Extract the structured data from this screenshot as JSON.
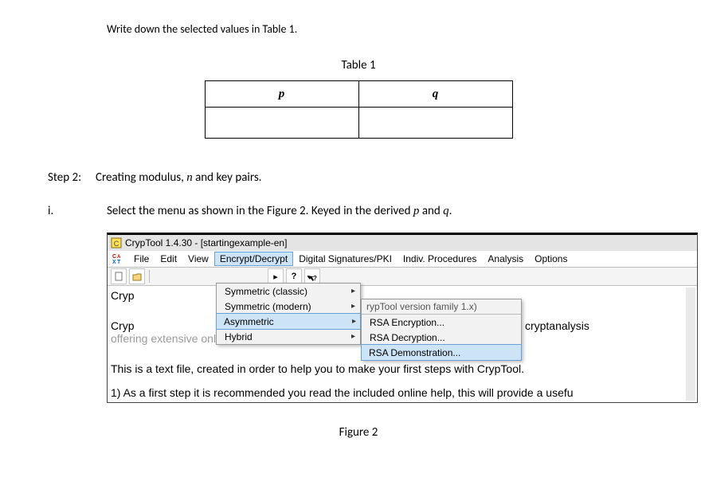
{
  "instruction": "Write down the selected values in Table 1.",
  "table": {
    "caption": "Table 1",
    "header_p": "p",
    "header_q": "q",
    "val_p": "",
    "val_q": ""
  },
  "step2": {
    "label": "Step 2:",
    "text_pre": "Creating modulus, ",
    "text_n": "n",
    "text_post": " and key pairs."
  },
  "sub_i": {
    "label": "i.",
    "pre": "Select the menu as shown in the Figure 2. Keyed in the derived ",
    "p": "p",
    "and": " and ",
    "q": "q",
    "post": "."
  },
  "shot": {
    "title": "CrypTool 1.4.30 - [startingexample-en]",
    "menus": {
      "file": "File",
      "edit": "Edit",
      "view": "View",
      "encdec": "Encrypt/Decrypt",
      "digsig": "Digital Signatures/PKI",
      "indiv": "Indiv. Procedures",
      "analysis": "Analysis",
      "options": "Options"
    },
    "dd1": {
      "sym_classic": "Symmetric (classic)",
      "sym_modern": "Symmetric (modern)",
      "asym": "Asymmetric",
      "hybrid": "Hybrid"
    },
    "dd2": {
      "top": "rypTool version family 1.x)",
      "rsa_enc": "RSA Encryption...",
      "rsa_dec": "RSA Decryption...",
      "rsa_demo": "RSA Demonstration..."
    },
    "doclabel1": "Cryp",
    "doclabel2a": "Cryp",
    "doclabel2b": "offering extensive online help and m",
    "rightnote": "graphy and cryptanalysis",
    "body_line1": "This is a text file, created in order to help you to make your first steps with CrypTool.",
    "body_line2": "1) As a first step it is recommended you read the included online help, this will provide a usefu"
  },
  "figure_caption": "Figure 2"
}
